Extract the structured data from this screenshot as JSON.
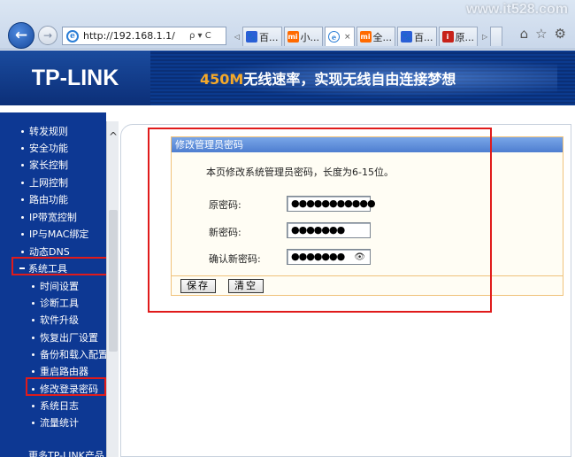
{
  "browser": {
    "url": "http://192.168.1.1/",
    "address_controls": "ρ ▾ C",
    "tabs": [
      {
        "icon": "paw-icon",
        "label": "百..."
      },
      {
        "icon": "mi-icon",
        "label": "小..."
      },
      {
        "icon": "ie-icon",
        "label": "",
        "active": true
      },
      {
        "icon": "mi-icon",
        "label": "全..."
      },
      {
        "icon": "paw-icon",
        "label": "百..."
      },
      {
        "icon": "red-i-icon",
        "label": "原..."
      }
    ],
    "tab_close": "×",
    "watermark": "www.it528.com"
  },
  "header": {
    "logo": "TP-LINK",
    "slogan_highlight": "450M",
    "slogan_rest": "无线速率，实现无线自由连接梦想"
  },
  "menu": {
    "items": [
      {
        "label": "转发规则",
        "level": 1
      },
      {
        "label": "安全功能",
        "level": 1
      },
      {
        "label": "家长控制",
        "level": 1
      },
      {
        "label": "上网控制",
        "level": 1
      },
      {
        "label": "路由功能",
        "level": 1
      },
      {
        "label": "IP带宽控制",
        "level": 1
      },
      {
        "label": "IP与MAC绑定",
        "level": 1
      },
      {
        "label": "动态DNS",
        "level": 1
      },
      {
        "label": "系统工具",
        "level": 1,
        "expanded": true
      },
      {
        "label": "时间设置",
        "level": 2
      },
      {
        "label": "诊断工具",
        "level": 2
      },
      {
        "label": "软件升级",
        "level": 2
      },
      {
        "label": "恢复出厂设置",
        "level": 2
      },
      {
        "label": "备份和载入配置",
        "level": 2
      },
      {
        "label": "重启路由器",
        "level": 2
      },
      {
        "label": "修改登录密码",
        "level": 2,
        "selected": true
      },
      {
        "label": "系统日志",
        "level": 2
      },
      {
        "label": "流量统计",
        "level": 2
      },
      {
        "label": "更多TP-LINK产品,",
        "level": 0
      }
    ]
  },
  "panel": {
    "title": "修改管理员密码",
    "description": "本页修改系统管理员密码，长度为6-15位。",
    "fields": [
      {
        "label": "原密码:",
        "value": "●●●●●●●●●●●"
      },
      {
        "label": "新密码:",
        "value": "●●●●●●●"
      },
      {
        "label": "确认新密码:",
        "value": "●●●●●●●"
      }
    ],
    "save_label": "保存",
    "clear_label": "清空"
  },
  "colors": {
    "menu_bg": "#0d3893",
    "header_bg": "#0a2f7c",
    "panel_title": "#5b88d6",
    "panel_border": "#f0c27a",
    "highlight": "#e01b1b",
    "slogan_accent": "#f5a92a"
  }
}
